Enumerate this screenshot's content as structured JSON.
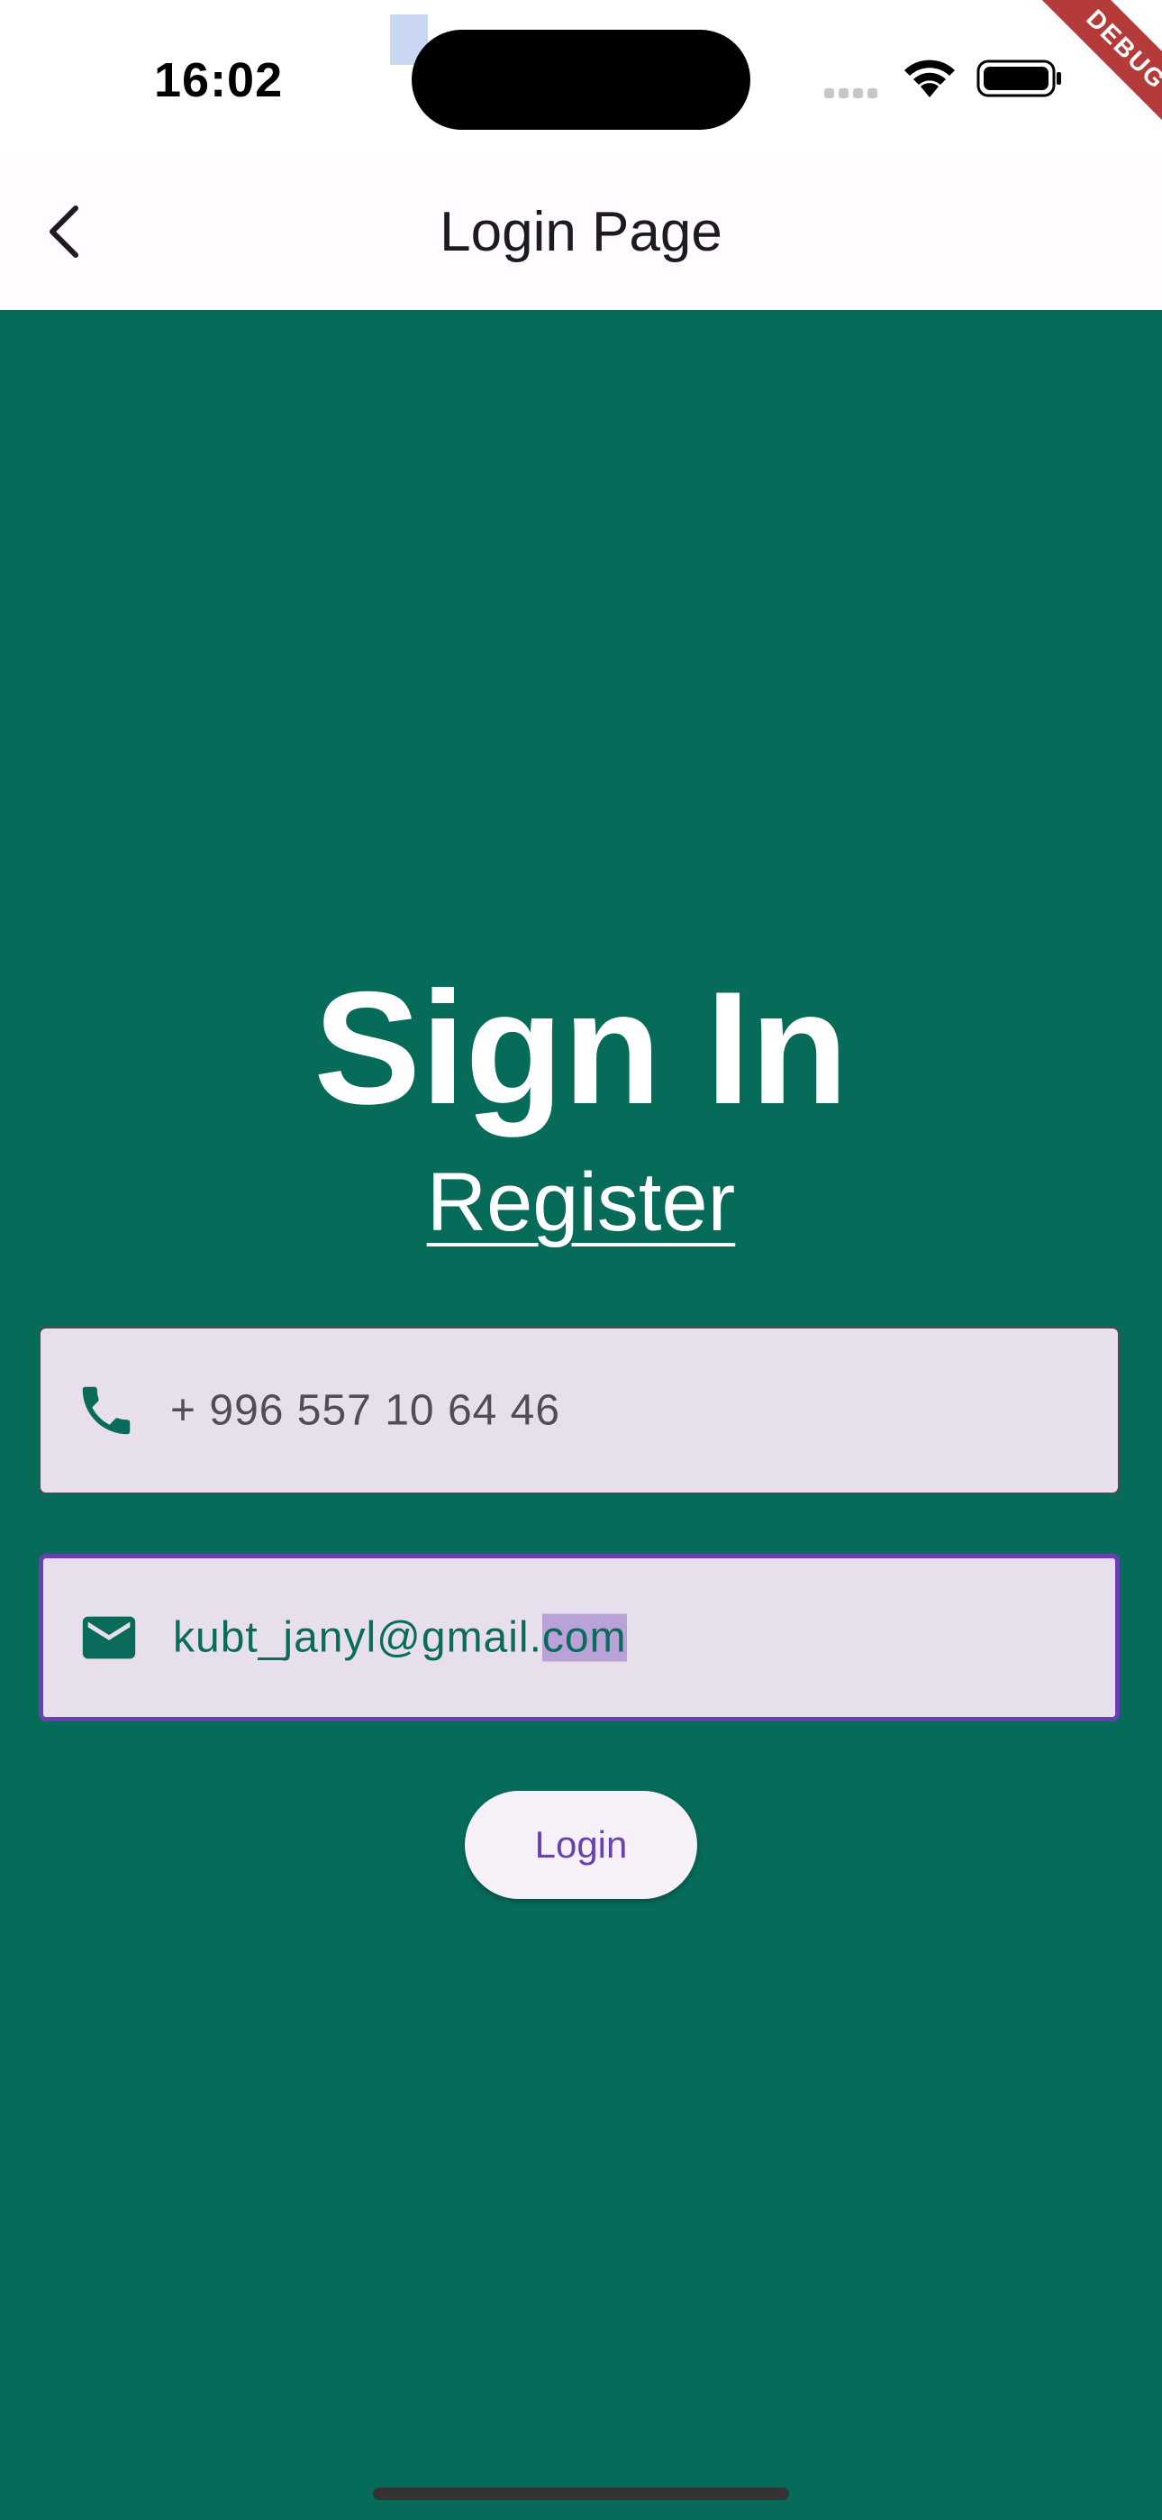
{
  "status_bar": {
    "time": "16:02",
    "debug_label": "DEBUG"
  },
  "app_bar": {
    "title": "Login Page",
    "back_icon": "chevron-left-icon"
  },
  "main": {
    "heading": "Sign In",
    "register_link": "Register",
    "phone_field": {
      "value": "+ 996 557 10 64 46",
      "icon": "phone-icon"
    },
    "email_field": {
      "value_plain": "kubt_janyl@gmail.",
      "value_selected": "com",
      "icon": "email-icon"
    },
    "login_button": "Login"
  },
  "colors": {
    "background": "#066b59",
    "accent": "#6842b0",
    "field_fill": "#e7e0ec",
    "debug_banner": "#b53a3a"
  }
}
